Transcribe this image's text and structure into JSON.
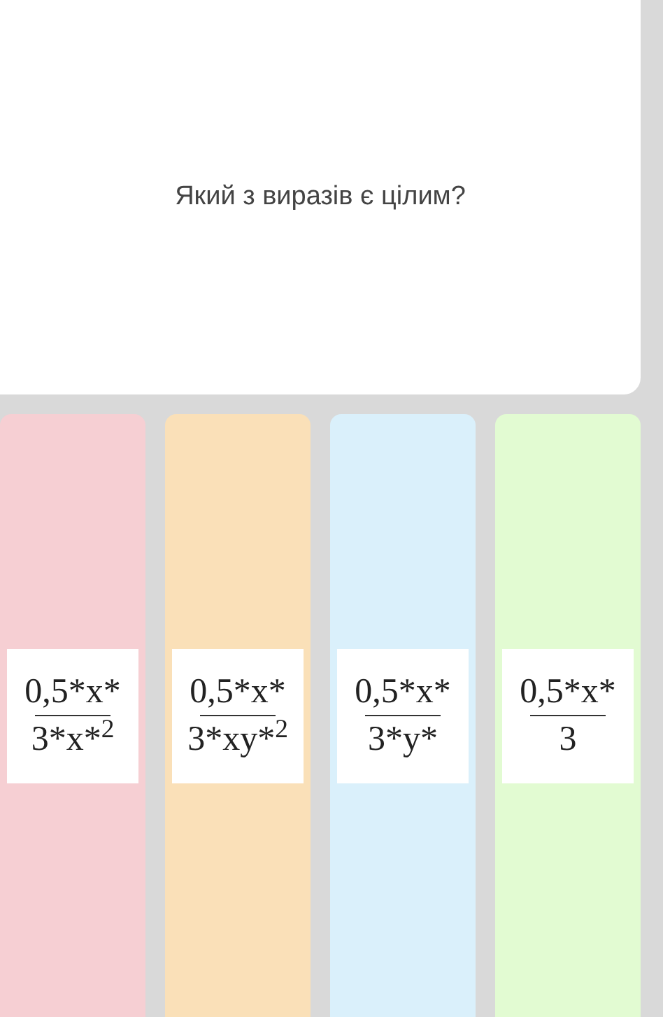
{
  "question": {
    "text": "Який з виразів є цілим?"
  },
  "answers": [
    {
      "color": "#f6cfd3",
      "numerator": "0,5*x*",
      "denominator": "3*x*$^{2}$"
    },
    {
      "color": "#fae0b8",
      "numerator": "0,5*x*",
      "denominator": "3*xy*$^{2}$"
    },
    {
      "color": "#daf0fb",
      "numerator": "0,5*x*",
      "denominator": "3*y*"
    },
    {
      "color": "#e2fbd2",
      "numerator": "0,5*x*",
      "denominator": "3"
    }
  ]
}
